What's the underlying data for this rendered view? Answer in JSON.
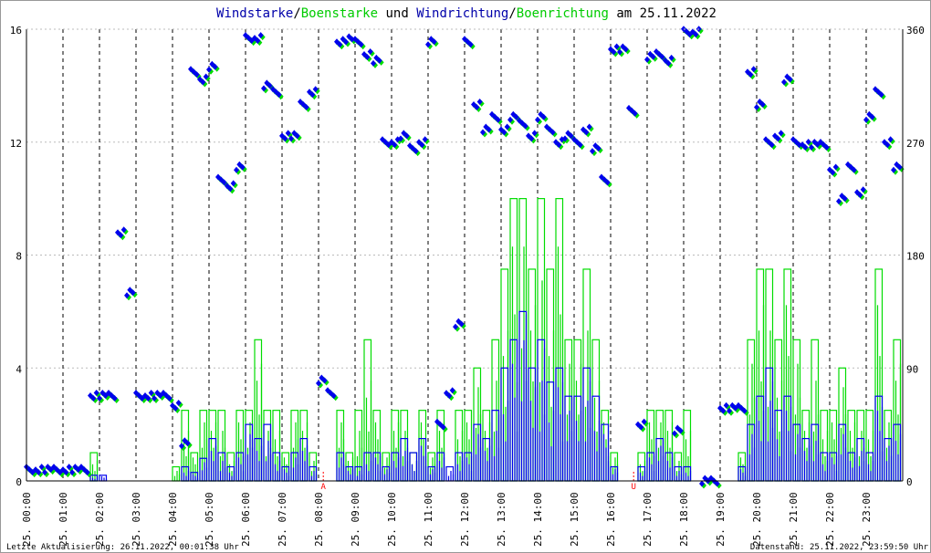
{
  "title": {
    "part1": "Windstarke",
    "sep1": "/",
    "part2": "Boenstarke",
    "mid": " und ",
    "part3": "Windrichtung",
    "sep2": "/",
    "part4": "Boenrichtung",
    "end": " am 25.11.2022"
  },
  "footer": {
    "left": "Letzte Aktualisierung: 26.11.2022, 00:01:38 Uhr",
    "right": "Datenstand: 25.11.2022, 23:59:50 Uhr"
  },
  "colors": {
    "wind": "#0000ee",
    "gust": "#00dd00",
    "marker": "#ff0000",
    "title_blue": "#0000aa",
    "title_green": "#00cc00"
  },
  "chart_data": {
    "type": "line",
    "x_interval_minutes": 15,
    "x_range_hours": [
      0,
      24
    ],
    "xtick_labels": [
      "25. 00:00",
      "25. 01:00",
      "25. 02:00",
      "25. 03:00",
      "25. 04:00",
      "25. 05:00",
      "25. 06:00",
      "25. 07:00",
      "25. 08:00",
      "25. 09:00",
      "25. 10:00",
      "25. 11:00",
      "25. 12:00",
      "25. 13:00",
      "25. 14:00",
      "25. 15:00",
      "25. 16:00",
      "25. 17:00",
      "25. 18:00",
      "25. 19:00",
      "25. 20:00",
      "25. 21:00",
      "25. 22:00",
      "25. 23:00"
    ],
    "y_left": {
      "range": [
        0,
        16
      ],
      "ticks": [
        "0",
        "4",
        "8",
        "12",
        "16"
      ]
    },
    "y_right": {
      "range": [
        0,
        360
      ],
      "ticks": [
        "0",
        "90",
        "180",
        "270",
        "360"
      ]
    },
    "grid": true,
    "markers": [
      {
        "label": "A",
        "time_hours": 8.13
      },
      {
        "label": "U",
        "time_hours": 16.63
      }
    ],
    "series": [
      {
        "name": "Boenstarke",
        "axis": "left",
        "values": [
          0,
          0,
          0,
          0,
          0,
          0,
          0,
          1,
          0,
          0,
          0,
          0,
          0,
          0,
          0,
          0,
          0.5,
          2.5,
          1,
          2.5,
          2.5,
          2.5,
          1,
          2.5,
          2.5,
          5,
          2.5,
          2.5,
          1,
          2.5,
          2.5,
          1,
          0,
          0,
          2.5,
          1,
          2.5,
          5,
          2.5,
          1,
          2.5,
          2.5,
          1,
          2.5,
          1,
          2.5,
          0,
          2.5,
          2.5,
          4,
          2.5,
          5,
          7.5,
          10,
          10,
          7.5,
          10,
          7.5,
          10,
          5,
          5,
          7.5,
          5,
          2.5,
          1,
          0,
          0,
          1,
          2.5,
          2.5,
          2.5,
          1,
          2.5,
          0,
          0,
          0,
          0,
          0,
          1,
          5,
          7.5,
          7.5,
          5,
          7.5,
          5,
          2.5,
          5,
          2.5,
          2.5,
          4,
          2.5,
          2.5,
          2.5,
          7.5,
          2.5,
          5
        ]
      },
      {
        "name": "Windstarke",
        "axis": "left",
        "values": [
          0,
          0,
          0,
          0,
          0,
          0,
          0,
          0.2,
          0.2,
          0,
          0,
          0,
          0,
          0,
          0,
          0,
          0,
          0.5,
          0.3,
          0.8,
          1.5,
          1,
          0.5,
          1,
          2,
          1.5,
          2,
          1,
          0.5,
          1,
          1.5,
          0.5,
          0,
          0,
          1,
          0.5,
          0.5,
          1,
          1,
          0.5,
          1,
          1.5,
          1,
          1.5,
          0.5,
          1,
          0.5,
          1,
          1,
          2,
          1.5,
          2.5,
          4,
          5,
          6,
          4,
          5,
          3.5,
          4,
          3,
          3,
          4,
          3,
          2,
          0.5,
          0,
          0,
          0.5,
          1,
          1.5,
          1,
          0.5,
          0.5,
          0,
          0,
          0,
          0,
          0,
          0.5,
          2,
          3,
          4,
          2.5,
          3,
          2,
          1.5,
          2,
          1,
          1,
          2,
          1,
          1.5,
          1,
          3,
          1.5,
          2
        ]
      },
      {
        "name": "Boenrichtung",
        "axis": "right",
        "values": [
          9,
          9,
          9,
          9,
          9,
          9,
          9,
          68,
          68,
          68,
          198,
          150,
          68,
          68,
          68,
          68,
          60,
          30,
          326,
          320,
          330,
          240,
          235,
          250,
          353,
          353,
          315,
          310,
          275,
          275,
          300,
          310,
          80,
          70,
          350,
          352,
          350,
          340,
          335,
          270,
          270,
          275,
          265,
          270,
          350,
          45,
          70,
          125,
          350,
          300,
          280,
          290,
          280,
          290,
          285,
          275,
          290,
          280,
          270,
          275,
          270,
          280,
          265,
          240,
          344,
          344,
          295,
          45,
          338,
          340,
          335,
          40,
          358,
          358,
          0,
          0,
          58,
          58,
          58,
          326,
          300,
          270,
          275,
          320,
          270,
          268,
          268,
          268,
          248,
          225,
          250,
          230,
          290,
          310,
          270,
          250
        ]
      },
      {
        "name": "Windrichtung",
        "axis": "right",
        "values": [
          9,
          9,
          9,
          9,
          9,
          9,
          9,
          68,
          68,
          68,
          198,
          150,
          68,
          68,
          68,
          68,
          60,
          30,
          326,
          320,
          330,
          240,
          235,
          250,
          353,
          353,
          315,
          310,
          275,
          275,
          300,
          310,
          80,
          70,
          350,
          352,
          350,
          340,
          335,
          270,
          270,
          275,
          265,
          270,
          350,
          45,
          70,
          125,
          350,
          300,
          280,
          290,
          280,
          290,
          285,
          275,
          290,
          280,
          270,
          275,
          270,
          280,
          265,
          240,
          344,
          344,
          295,
          45,
          338,
          340,
          335,
          40,
          358,
          358,
          0,
          0,
          58,
          58,
          58,
          326,
          300,
          270,
          275,
          320,
          270,
          268,
          268,
          268,
          248,
          225,
          250,
          230,
          290,
          310,
          270,
          250
        ]
      }
    ]
  }
}
